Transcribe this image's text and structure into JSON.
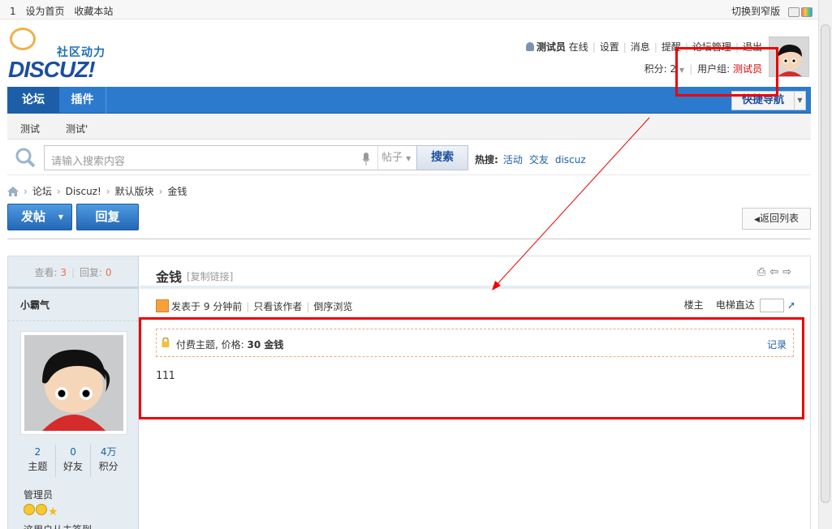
{
  "topbar": {
    "left_items": [
      "1",
      "设为首页",
      "收藏本站"
    ],
    "switch_label": "切换到窄版"
  },
  "logo": {
    "tagline": "社区动力",
    "wordmark": "DISCUZ!"
  },
  "user": {
    "name": "测试员",
    "status": "在线",
    "links": [
      "设置",
      "消息",
      "提醒",
      "论坛管理",
      "退出"
    ],
    "credits_label": "积分: 2",
    "group_label": "用户组:",
    "group_value": "测试员"
  },
  "nav": {
    "items": [
      "论坛",
      "插件"
    ],
    "quick_nav": "快捷导航"
  },
  "subnav": [
    "测试",
    "测试'"
  ],
  "search": {
    "placeholder": "请输入搜索内容",
    "scope": "帖子",
    "button": "搜索",
    "hot_label": "热搜:",
    "hot_items": [
      "活动",
      "交友",
      "discuz"
    ]
  },
  "breadcrumb": [
    "论坛",
    "Discuz!",
    "默认版块",
    "金钱"
  ],
  "actions": {
    "post": "发帖",
    "reply": "回复",
    "back": "返回列表"
  },
  "sidebar": {
    "views_label": "查看:",
    "views": "3",
    "replies_label": "回复:",
    "replies": "0",
    "author": "小霸气",
    "counts": [
      {
        "value": "2",
        "label": "主题"
      },
      {
        "value": "0",
        "label": "好友"
      },
      {
        "value": "4万",
        "label": "积分"
      }
    ],
    "role": "管理员",
    "signature": "这用户从未签到"
  },
  "post": {
    "title": "金钱",
    "copy_link": "[复制链接]",
    "posted": "发表于 9 分钟前",
    "only_author": "只看该作者",
    "reverse": "倒序浏览",
    "floor": "楼主",
    "jump": "电梯直达",
    "paid_prefix": "付费主题, 价格:",
    "paid_price": "30 金钱",
    "record": "记录",
    "body": "111"
  }
}
